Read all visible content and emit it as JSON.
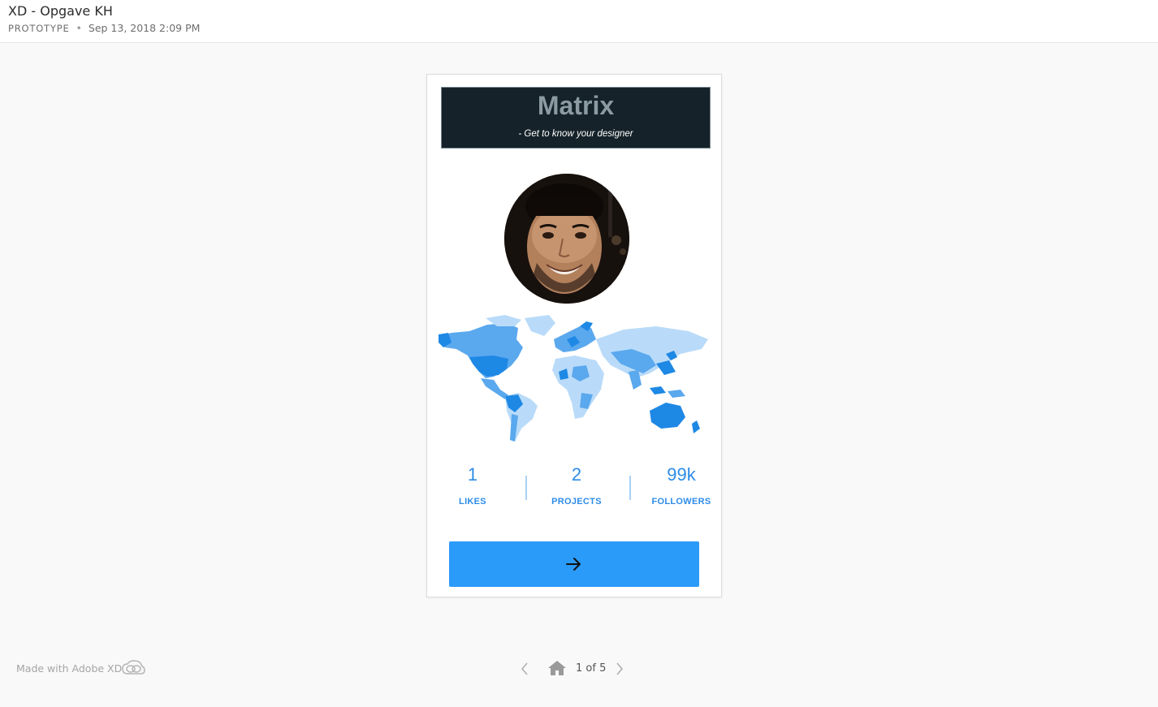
{
  "header": {
    "title": "XD - Opgave KH",
    "kind": "PROTOTYPE",
    "separator": "•",
    "timestamp": "Sep 13, 2018 2:09 PM"
  },
  "screen": {
    "banner_title": "Matrix",
    "banner_subtitle": "- Get to know your designer",
    "avatar_icon": "profile-photo",
    "map_icon": "world-map",
    "stats": [
      {
        "value": "1",
        "label": "LIKES"
      },
      {
        "value": "2",
        "label": "PROJECTS"
      },
      {
        "value": "99k",
        "label": "FOLLOWERS"
      }
    ],
    "next_icon": "arrow-right-icon"
  },
  "footer": {
    "made_with": "Made with Adobe XD",
    "page_counter": "1 of 5"
  },
  "colors": {
    "accent": "#2b9bfa",
    "stat_text": "#2d8ce7",
    "banner_bg": "#152229",
    "banner_title": "#8b9aa3",
    "map_dark": "#1e88e5",
    "map_mid": "#5aa8ee",
    "map_light": "#b9dbf9"
  }
}
